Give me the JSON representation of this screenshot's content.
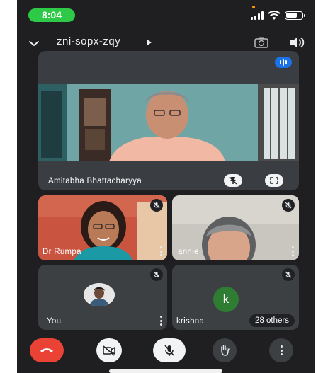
{
  "status_bar": {
    "time": "8:04",
    "icons": [
      "signal-icon",
      "wifi-icon",
      "battery-icon"
    ]
  },
  "meeting": {
    "code": "zni-sopx-zqy",
    "icons": [
      "chevron-down-icon",
      "play-arrow-icon",
      "switch-camera-icon",
      "speaker-icon"
    ]
  },
  "main_tile": {
    "participant_name": "Amitabha Bhattacharyya",
    "icons": [
      "audio-level-icon",
      "pin-off-icon",
      "fullscreen-icon"
    ]
  },
  "tiles": [
    {
      "name": "Dr Rumpa",
      "muted": true,
      "icons": [
        "mic-off-icon",
        "more-vert-icon"
      ]
    },
    {
      "name": "annie",
      "muted": true,
      "icons": [
        "mic-off-icon",
        "more-vert-icon"
      ]
    },
    {
      "name": "You",
      "muted": true,
      "icons": [
        "mic-off-icon",
        "more-vert-icon"
      ]
    },
    {
      "name": "krishna",
      "avatar_letter": "k",
      "muted": true,
      "others_label": "28 others",
      "icons": [
        "mic-off-icon"
      ]
    }
  ],
  "controls": {
    "icons": [
      "end-call-icon",
      "video-off-icon",
      "mic-off-icon",
      "raise-hand-icon",
      "more-vert-icon"
    ]
  },
  "colors": {
    "background": "#1f1f21",
    "tile": "#3c4043",
    "end_call": "#ea4335",
    "audio_active": "#1a73e8",
    "avatar_k": "#2e7d32",
    "time_pill": "#2ec946"
  }
}
